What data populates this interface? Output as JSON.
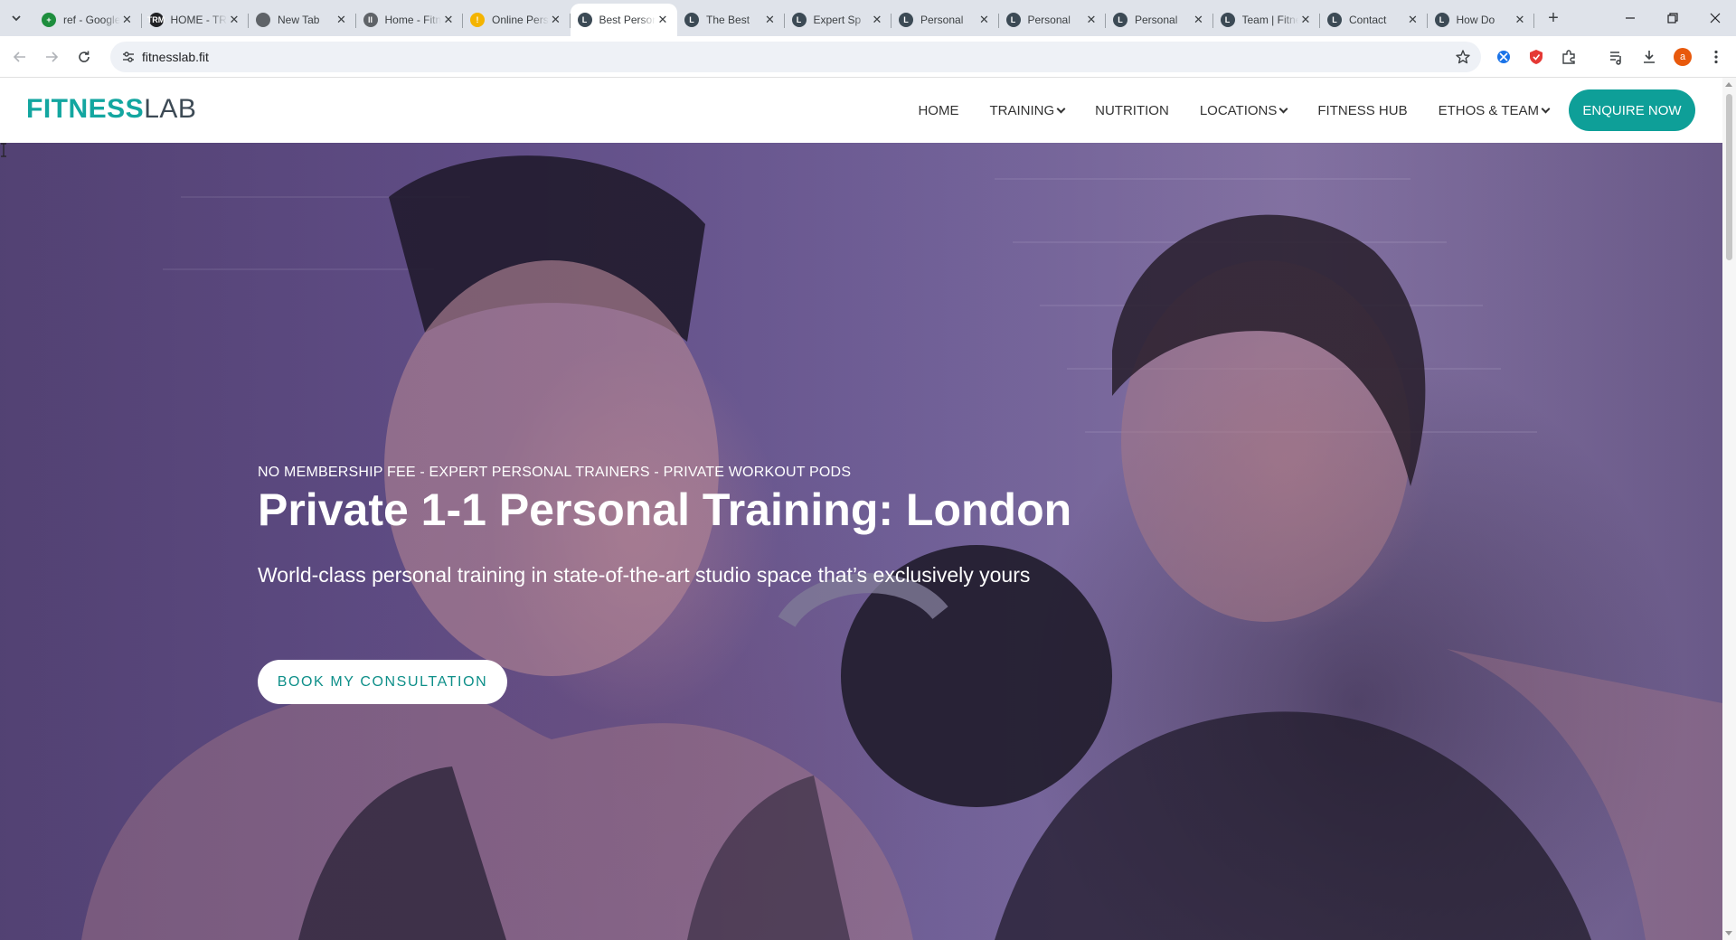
{
  "browser": {
    "tabs": [
      {
        "title": "ref - Google Sheets",
        "favicon": "sheets-icon",
        "color": "#1e8e3e",
        "glyph": "+"
      },
      {
        "title": "HOME - TRM",
        "favicon": "trm-icon",
        "color": "#202124",
        "glyph": "TRM"
      },
      {
        "title": "New Tab",
        "favicon": "chrome-icon",
        "color": "#5f6368",
        "glyph": ""
      },
      {
        "title": "Home - Fitness",
        "favicon": "ll-icon",
        "color": "#5f6368",
        "glyph": "ll"
      },
      {
        "title": "Online Personal",
        "favicon": "bolt-icon",
        "color": "#f4b400",
        "glyph": "!"
      },
      {
        "title": "Best Personal Training",
        "favicon": "fitnesslab-icon",
        "color": "#3c4a55",
        "glyph": "L"
      },
      {
        "title": "The Best",
        "favicon": "fitnesslab-icon",
        "color": "#3c4a55",
        "glyph": "L"
      },
      {
        "title": "Expert Sp",
        "favicon": "fitnesslab-icon",
        "color": "#3c4a55",
        "glyph": "L"
      },
      {
        "title": "Personal",
        "favicon": "fitnesslab-icon",
        "color": "#3c4a55",
        "glyph": "L"
      },
      {
        "title": "Personal",
        "favicon": "fitnesslab-icon",
        "color": "#3c4a55",
        "glyph": "L"
      },
      {
        "title": "Personal",
        "favicon": "fitnesslab-icon",
        "color": "#3c4a55",
        "glyph": "L"
      },
      {
        "title": "Team | Fitness",
        "favicon": "fitnesslab-icon",
        "color": "#3c4a55",
        "glyph": "L"
      },
      {
        "title": "Contact",
        "favicon": "fitnesslab-icon",
        "color": "#3c4a55",
        "glyph": "L"
      },
      {
        "title": "How Do",
        "favicon": "fitnesslab-icon",
        "color": "#3c4a55",
        "glyph": "L"
      }
    ],
    "active_tab_index": 5,
    "url": "fitnesslab.fit",
    "profile_initial": "a"
  },
  "site": {
    "logo_bold": "FITNESS",
    "logo_light": "LAB",
    "nav": [
      {
        "label": "HOME",
        "dropdown": false
      },
      {
        "label": "TRAINING",
        "dropdown": true
      },
      {
        "label": "NUTRITION",
        "dropdown": false
      },
      {
        "label": "LOCATIONS",
        "dropdown": true
      },
      {
        "label": "FITNESS HUB",
        "dropdown": false
      },
      {
        "label": "ETHOS & TEAM",
        "dropdown": true
      }
    ],
    "enquire_label": "ENQUIRE NOW",
    "accent_color": "#0e9f98"
  },
  "hero": {
    "eyebrow": "NO MEMBERSHIP FEE - EXPERT PERSONAL TRAINERS - PRIVATE WORKOUT PODS",
    "headline": "Private 1-1 Personal Training: London",
    "subhead": "World-class personal training in state-of-the-art studio space that’s exclusively yours",
    "cta_label": "BOOK MY CONSULTATION"
  }
}
